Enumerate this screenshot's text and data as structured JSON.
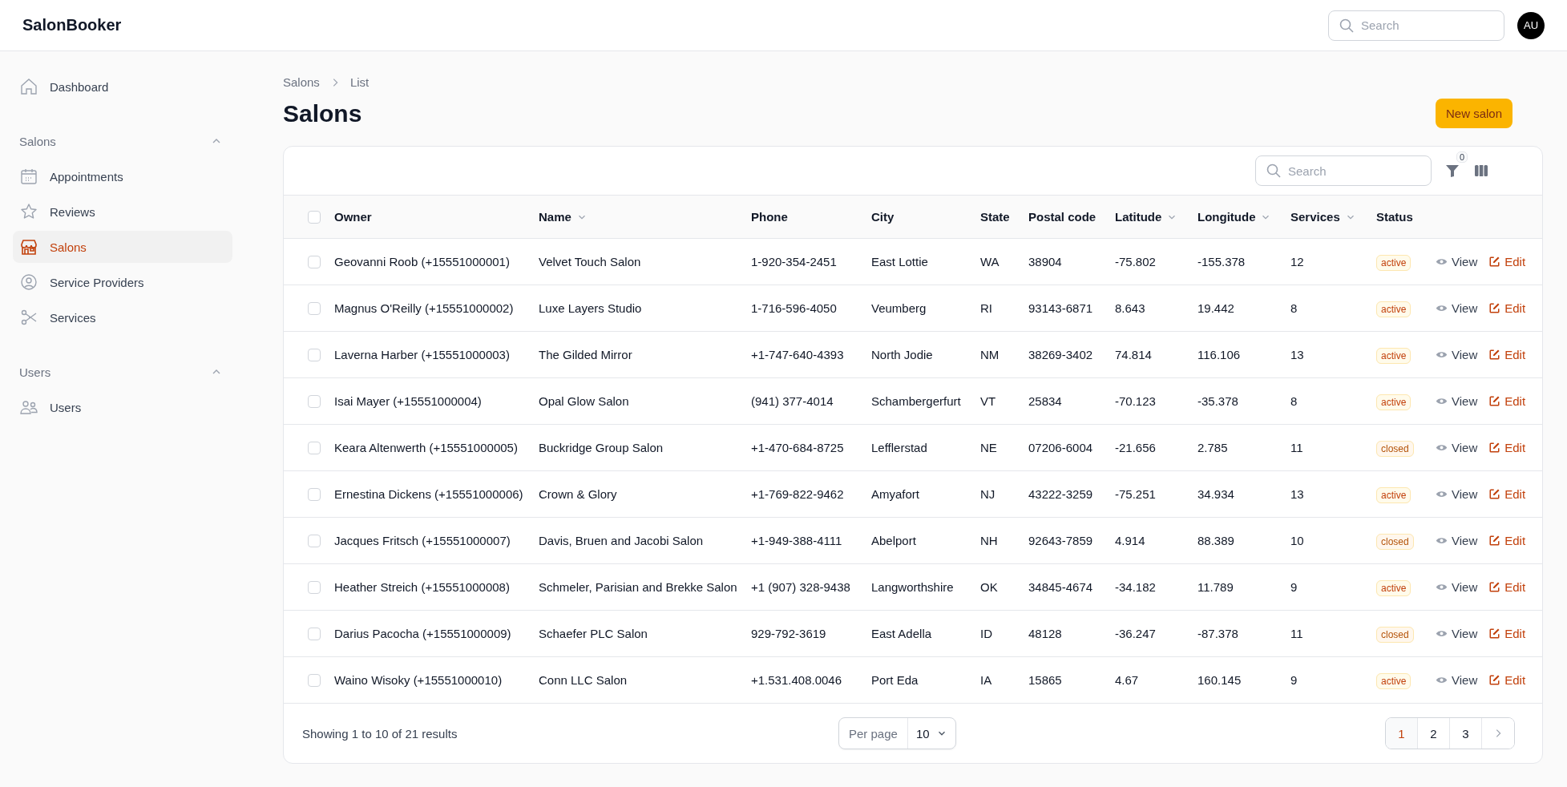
{
  "app": {
    "brand": "SalonBooker",
    "search": {
      "placeholder": "Search"
    },
    "avatar": "AU"
  },
  "sidebar": {
    "items": [
      {
        "label": "Dashboard",
        "selected": false
      }
    ],
    "groups": [
      {
        "label": "Salons",
        "expanded": true,
        "items": [
          {
            "label": "Appointments",
            "selected": false
          },
          {
            "label": "Reviews",
            "selected": false
          },
          {
            "label": "Salons",
            "selected": true
          },
          {
            "label": "Service Providers",
            "selected": false
          },
          {
            "label": "Services",
            "selected": false
          }
        ]
      },
      {
        "label": "Users",
        "expanded": true,
        "items": [
          {
            "label": "Users",
            "selected": false
          }
        ]
      }
    ]
  },
  "breadcrumb": [
    "Salons",
    "List"
  ],
  "title": "Salons",
  "new_button": "New salon",
  "table": {
    "search": {
      "placeholder": "Search"
    },
    "filter_count": "0",
    "all_checked": false,
    "columns": [
      {
        "label": "Owner",
        "sortable": false
      },
      {
        "label": "Name",
        "sortable": true
      },
      {
        "label": "Phone",
        "sortable": false
      },
      {
        "label": "City",
        "sortable": false
      },
      {
        "label": "State",
        "sortable": false
      },
      {
        "label": "Postal code",
        "sortable": false
      },
      {
        "label": "Latitude",
        "sortable": true
      },
      {
        "label": "Longitude",
        "sortable": true
      },
      {
        "label": "Services",
        "sortable": true
      },
      {
        "label": "Status",
        "sortable": false
      }
    ],
    "rows": [
      {
        "checked": false,
        "cells": [
          "Geovanni Roob (+15551000001)",
          "Velvet Touch Salon",
          "1-920-354-2451",
          "East Lottie",
          "WA",
          "38904",
          "-75.802",
          "-155.378",
          "12"
        ],
        "status": "active",
        "view": "View",
        "edit": "Edit"
      },
      {
        "checked": false,
        "cells": [
          "Magnus O'Reilly (+15551000002)",
          "Luxe Layers Studio",
          "1-716-596-4050",
          "Veumberg",
          "RI",
          "93143-6871",
          "8.643",
          "19.442",
          "8"
        ],
        "status": "active",
        "view": "View",
        "edit": "Edit"
      },
      {
        "checked": false,
        "cells": [
          "Laverna Harber (+15551000003)",
          "The Gilded Mirror",
          "+1-747-640-4393",
          "North Jodie",
          "NM",
          "38269-3402",
          "74.814",
          "116.106",
          "13"
        ],
        "status": "active",
        "view": "View",
        "edit": "Edit"
      },
      {
        "checked": false,
        "cells": [
          "Isai Mayer (+15551000004)",
          "Opal Glow Salon",
          "(941) 377-4014",
          "Schambergerfurt",
          "VT",
          "25834",
          "-70.123",
          "-35.378",
          "8"
        ],
        "status": "active",
        "view": "View",
        "edit": "Edit"
      },
      {
        "checked": false,
        "cells": [
          "Keara Altenwerth (+15551000005)",
          "Buckridge Group Salon",
          "+1-470-684-8725",
          "Lefflerstad",
          "NE",
          "07206-6004",
          "-21.656",
          "2.785",
          "11"
        ],
        "status": "closed",
        "view": "View",
        "edit": "Edit"
      },
      {
        "checked": false,
        "cells": [
          "Ernestina Dickens (+15551000006)",
          "Crown & Glory",
          "+1-769-822-9462",
          "Amyafort",
          "NJ",
          "43222-3259",
          "-75.251",
          "34.934",
          "13"
        ],
        "status": "active",
        "view": "View",
        "edit": "Edit"
      },
      {
        "checked": false,
        "cells": [
          "Jacques Fritsch (+15551000007)",
          "Davis, Bruen and Jacobi Salon",
          "+1-949-388-4111",
          "Abelport",
          "NH",
          "92643-7859",
          "4.914",
          "88.389",
          "10"
        ],
        "status": "closed",
        "view": "View",
        "edit": "Edit"
      },
      {
        "checked": false,
        "cells": [
          "Heather Streich (+15551000008)",
          "Schmeler, Parisian and Brekke Salon",
          "+1 (907) 328-9438",
          "Langworthshire",
          "OK",
          "34845-4674",
          "-34.182",
          "11.789",
          "9"
        ],
        "status": "active",
        "view": "View",
        "edit": "Edit"
      },
      {
        "checked": false,
        "cells": [
          "Darius Pacocha (+15551000009)",
          "Schaefer PLC Salon",
          "929-792-3619",
          "East Adella",
          "ID",
          "48128",
          "-36.247",
          "-87.378",
          "11"
        ],
        "status": "closed",
        "view": "View",
        "edit": "Edit"
      },
      {
        "checked": false,
        "cells": [
          "Waino Wisoky (+15551000010)",
          "Conn LLC Salon",
          "+1.531.408.0046",
          "Port Eda",
          "IA",
          "15865",
          "4.67",
          "160.145",
          "9"
        ],
        "status": "active",
        "view": "View",
        "edit": "Edit"
      }
    ]
  },
  "footer": {
    "summary": "Showing 1 to 10 of 21 results",
    "per_page_label": "Per page",
    "per_page": "10",
    "pages": [
      {
        "label": "1",
        "selected": true
      },
      {
        "label": "2",
        "selected": false
      },
      {
        "label": "3",
        "selected": false
      }
    ]
  }
}
